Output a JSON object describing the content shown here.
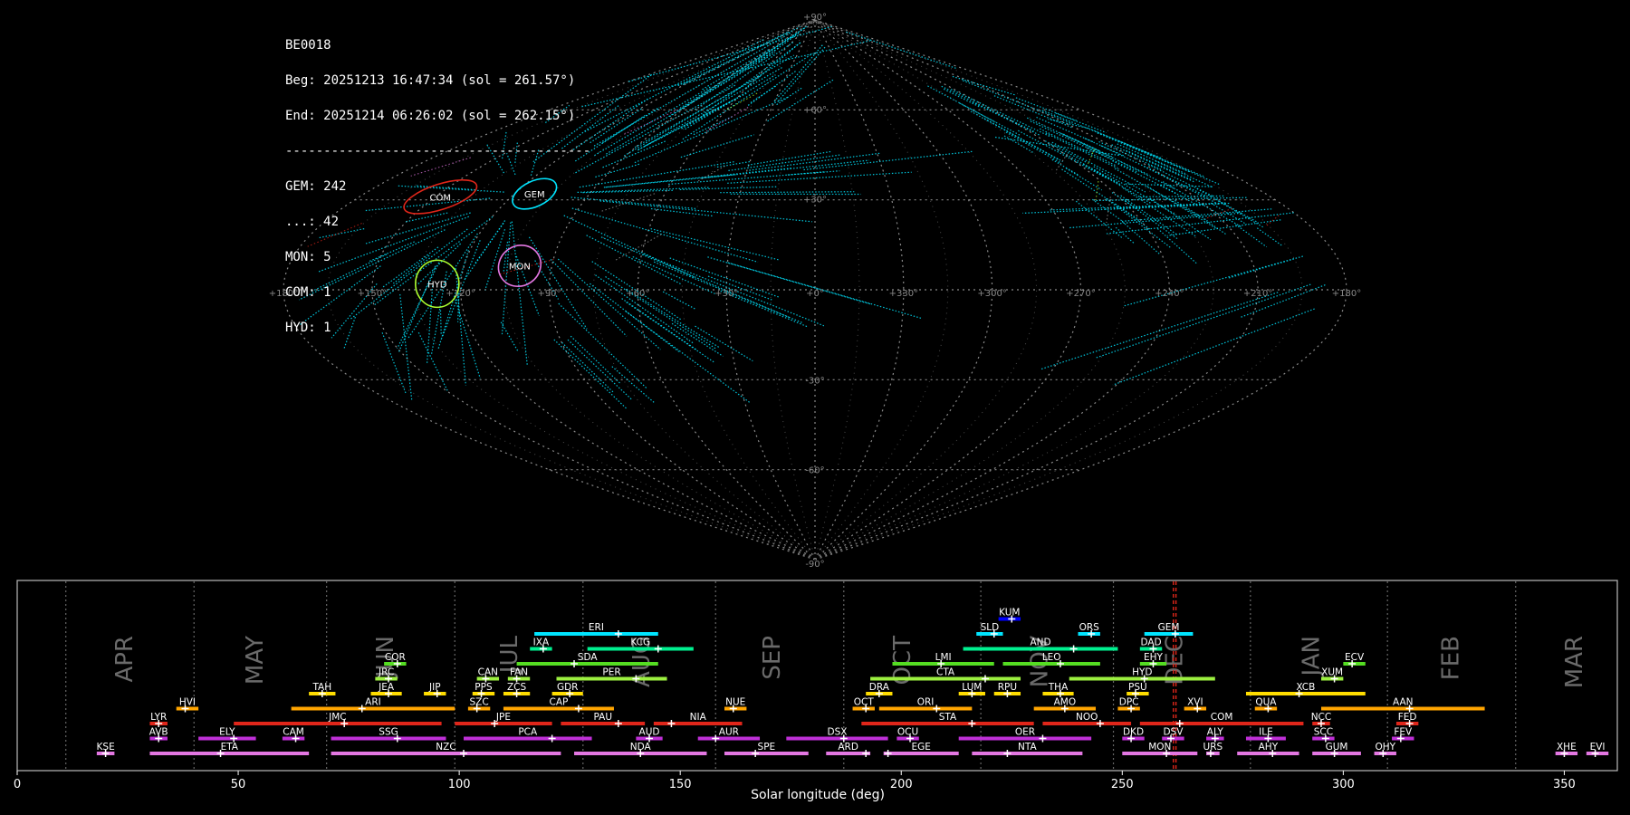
{
  "info_lines": [
    "BE0018",
    "Beg: 20251213 16:47:34 (sol = 261.57°)",
    "End: 20251214 06:26:02 (sol = 262.15°)",
    "----------------------------------------",
    "GEM: 242",
    "...: 42",
    "MON: 5",
    "COM: 1",
    "HYD: 1"
  ],
  "sky_map": {
    "projection": "sinusoidal",
    "lon_labels": [
      "+180°",
      "+150°",
      "+120°",
      "+90°",
      "+60°",
      "+30°",
      "+0°",
      "+330°",
      "+300°",
      "+270°",
      "+240°",
      "+210°",
      "+180°"
    ],
    "lat_labels": [
      "+90°",
      "+60°",
      "+30°",
      "-30°",
      "-60°",
      "-90°"
    ],
    "radiants": [
      {
        "code": "COM",
        "ra": 148,
        "dec": 31,
        "color": "#e0261a"
      },
      {
        "code": "GEM",
        "ra": 112,
        "dec": 32,
        "color": "#00e5ff"
      },
      {
        "code": "MON",
        "ra": 101,
        "dec": 8,
        "color": "#e377e2"
      },
      {
        "code": "HYD",
        "ra": 128,
        "dec": 2,
        "color": "#adff2f"
      }
    ]
  },
  "chart_data": {
    "type": "timeline",
    "xlabel": "Solar longitude (deg)",
    "xlim": [
      0,
      362
    ],
    "xticks": [
      0,
      50,
      100,
      150,
      200,
      250,
      300,
      350
    ],
    "current_sol": [
      261.57,
      262.15
    ],
    "months": [
      {
        "name": "APR",
        "x": 24.5
      },
      {
        "name": "MAY",
        "x": 54
      },
      {
        "name": "JUN",
        "x": 83.5
      },
      {
        "name": "JUL",
        "x": 111.5
      },
      {
        "name": "AUG",
        "x": 141.5
      },
      {
        "name": "SEP",
        "x": 171
      },
      {
        "name": "OCT",
        "x": 200.5
      },
      {
        "name": "NOV",
        "x": 231.5
      },
      {
        "name": "DEC",
        "x": 262
      },
      {
        "name": "JAN",
        "x": 293
      },
      {
        "name": "FEB",
        "x": 324.5
      },
      {
        "name": "MAR",
        "x": 352.5
      }
    ],
    "month_boundaries": [
      11,
      40,
      70,
      99,
      128,
      158,
      187,
      218,
      248,
      279,
      310,
      339
    ],
    "showers": [
      {
        "code": "KUM",
        "start": 222,
        "end": 227,
        "peak": 225,
        "row": 9,
        "color": "#0000ff"
      },
      {
        "code": "ERI",
        "start": 117,
        "end": 145,
        "peak": 136,
        "row": 8,
        "color": "#00e5ff"
      },
      {
        "code": "SLD",
        "start": 217,
        "end": 223,
        "peak": 221,
        "row": 8,
        "color": "#00e5ff"
      },
      {
        "code": "ORS",
        "start": 240,
        "end": 245,
        "peak": 243,
        "row": 8,
        "color": "#00e5ff"
      },
      {
        "code": "GEM",
        "start": 255,
        "end": 266,
        "peak": 262,
        "row": 8,
        "color": "#00e5ff"
      },
      {
        "code": "IXA",
        "start": 116,
        "end": 121,
        "peak": 119,
        "row": 7,
        "color": "#00f090"
      },
      {
        "code": "KCG",
        "start": 129,
        "end": 153,
        "peak": 145,
        "row": 7,
        "color": "#00f090"
      },
      {
        "code": "AND",
        "start": 214,
        "end": 249,
        "peak": 239,
        "row": 7,
        "color": "#00f090"
      },
      {
        "code": "DAD",
        "start": 254,
        "end": 259,
        "peak": 257,
        "row": 7,
        "color": "#00f090"
      },
      {
        "code": "COR",
        "start": 83,
        "end": 88,
        "peak": 86,
        "row": 6,
        "color": "#55dd22"
      },
      {
        "code": "SDA",
        "start": 113,
        "end": 145,
        "peak": 126,
        "row": 6,
        "color": "#55dd22"
      },
      {
        "code": "LMI",
        "start": 198,
        "end": 221,
        "peak": 209,
        "row": 6,
        "color": "#55dd22"
      },
      {
        "code": "LEO",
        "start": 223,
        "end": 245,
        "peak": 236,
        "row": 6,
        "color": "#55dd22"
      },
      {
        "code": "EHY",
        "start": 254,
        "end": 260,
        "peak": 257,
        "row": 6,
        "color": "#55dd22"
      },
      {
        "code": "ECV",
        "start": 300,
        "end": 305,
        "peak": 302,
        "row": 6,
        "color": "#55dd22"
      },
      {
        "code": "JRC",
        "start": 81,
        "end": 86,
        "peak": 84,
        "row": 5,
        "color": "#9cf040"
      },
      {
        "code": "CAN",
        "start": 104,
        "end": 109,
        "peak": 106,
        "row": 5,
        "color": "#9cf040"
      },
      {
        "code": "FAN",
        "start": 111,
        "end": 116,
        "peak": 113,
        "row": 5,
        "color": "#9cf040"
      },
      {
        "code": "PER",
        "start": 122,
        "end": 147,
        "peak": 140,
        "row": 5,
        "color": "#9cf040"
      },
      {
        "code": "CTA",
        "start": 193,
        "end": 227,
        "peak": 219,
        "row": 5,
        "color": "#9cf040"
      },
      {
        "code": "HYD",
        "start": 238,
        "end": 271,
        "peak": 255,
        "row": 5,
        "color": "#9cf040"
      },
      {
        "code": "XUM",
        "start": 295,
        "end": 300,
        "peak": 298,
        "row": 5,
        "color": "#9cf040"
      },
      {
        "code": "TAH",
        "start": 66,
        "end": 72,
        "peak": 69,
        "row": 4,
        "color": "#ffdd00"
      },
      {
        "code": "JEA",
        "start": 80,
        "end": 87,
        "peak": 84,
        "row": 4,
        "color": "#ffdd00"
      },
      {
        "code": "JIP",
        "start": 92,
        "end": 97,
        "peak": 95,
        "row": 4,
        "color": "#ffdd00"
      },
      {
        "code": "PPS",
        "start": 103,
        "end": 108,
        "peak": 105,
        "row": 4,
        "color": "#ffdd00"
      },
      {
        "code": "ZCS",
        "start": 110,
        "end": 116,
        "peak": 113,
        "row": 4,
        "color": "#ffdd00"
      },
      {
        "code": "GDR",
        "start": 121,
        "end": 128,
        "peak": 125,
        "row": 4,
        "color": "#ffdd00"
      },
      {
        "code": "DRA",
        "start": 192,
        "end": 198,
        "peak": 195,
        "row": 4,
        "color": "#ffdd00"
      },
      {
        "code": "LUM",
        "start": 213,
        "end": 219,
        "peak": 216,
        "row": 4,
        "color": "#ffdd00"
      },
      {
        "code": "RPU",
        "start": 221,
        "end": 227,
        "peak": 224,
        "row": 4,
        "color": "#ffdd00"
      },
      {
        "code": "THA",
        "start": 232,
        "end": 239,
        "peak": 236,
        "row": 4,
        "color": "#ffdd00"
      },
      {
        "code": "PSU",
        "start": 251,
        "end": 256,
        "peak": 253,
        "row": 4,
        "color": "#ffdd00"
      },
      {
        "code": "XCB",
        "start": 278,
        "end": 305,
        "peak": 290,
        "row": 4,
        "color": "#ffdd00"
      },
      {
        "code": "HVI",
        "start": 36,
        "end": 41,
        "peak": 38,
        "row": 3,
        "color": "#ffa500"
      },
      {
        "code": "ARI",
        "start": 62,
        "end": 99,
        "peak": 78,
        "row": 3,
        "color": "#ffa500"
      },
      {
        "code": "SZC",
        "start": 102,
        "end": 107,
        "peak": 104,
        "row": 3,
        "color": "#ffa500"
      },
      {
        "code": "CAP",
        "start": 110,
        "end": 135,
        "peak": 127,
        "row": 3,
        "color": "#ffa500"
      },
      {
        "code": "NUE",
        "start": 160,
        "end": 165,
        "peak": 162,
        "row": 3,
        "color": "#ffa500"
      },
      {
        "code": "OCT",
        "start": 189,
        "end": 194,
        "peak": 192,
        "row": 3,
        "color": "#ffa500"
      },
      {
        "code": "ORI",
        "start": 195,
        "end": 216,
        "peak": 208,
        "row": 3,
        "color": "#ffa500"
      },
      {
        "code": "AMO",
        "start": 230,
        "end": 244,
        "peak": 237,
        "row": 3,
        "color": "#ffa500"
      },
      {
        "code": "DPC",
        "start": 249,
        "end": 254,
        "peak": 252,
        "row": 3,
        "color": "#ffa500"
      },
      {
        "code": "XVI",
        "start": 264,
        "end": 269,
        "peak": 267,
        "row": 3,
        "color": "#ffa500"
      },
      {
        "code": "QUA",
        "start": 280,
        "end": 285,
        "peak": 283,
        "row": 3,
        "color": "#ffa500"
      },
      {
        "code": "AAN",
        "start": 295,
        "end": 332,
        "peak": 315,
        "row": 3,
        "color": "#ffa500"
      },
      {
        "code": "LYR",
        "start": 30,
        "end": 34,
        "peak": 32,
        "row": 2,
        "color": "#e0261a"
      },
      {
        "code": "JMC",
        "start": 49,
        "end": 96,
        "peak": 74,
        "row": 2,
        "color": "#e0261a"
      },
      {
        "code": "JPE",
        "start": 99,
        "end": 121,
        "peak": 108,
        "row": 2,
        "color": "#e0261a"
      },
      {
        "code": "PAU",
        "start": 123,
        "end": 142,
        "peak": 136,
        "row": 2,
        "color": "#e0261a"
      },
      {
        "code": "NIA",
        "start": 144,
        "end": 164,
        "peak": 148,
        "row": 2,
        "color": "#e0261a"
      },
      {
        "code": "STA",
        "start": 191,
        "end": 230,
        "peak": 216,
        "row": 2,
        "color": "#e0261a"
      },
      {
        "code": "NOO",
        "start": 232,
        "end": 252,
        "peak": 245,
        "row": 2,
        "color": "#e0261a"
      },
      {
        "code": "COM",
        "start": 254,
        "end": 291,
        "peak": 263,
        "row": 2,
        "color": "#e0261a"
      },
      {
        "code": "NCC",
        "start": 293,
        "end": 297,
        "peak": 295,
        "row": 2,
        "color": "#e0261a"
      },
      {
        "code": "FED",
        "start": 312,
        "end": 317,
        "peak": 315,
        "row": 2,
        "color": "#e0261a"
      },
      {
        "code": "AVB",
        "start": 30,
        "end": 34,
        "peak": 32,
        "row": 1,
        "color": "#c030d8"
      },
      {
        "code": "ELY",
        "start": 41,
        "end": 54,
        "peak": 49,
        "row": 1,
        "color": "#c030d8"
      },
      {
        "code": "CAM",
        "start": 60,
        "end": 65,
        "peak": 63,
        "row": 1,
        "color": "#c030d8"
      },
      {
        "code": "SSG",
        "start": 71,
        "end": 97,
        "peak": 86,
        "row": 1,
        "color": "#c030d8"
      },
      {
        "code": "PCA",
        "start": 101,
        "end": 130,
        "peak": 121,
        "row": 1,
        "color": "#c030d8"
      },
      {
        "code": "AUD",
        "start": 140,
        "end": 146,
        "peak": 143,
        "row": 1,
        "color": "#c030d8"
      },
      {
        "code": "AUR",
        "start": 154,
        "end": 168,
        "peak": 158,
        "row": 1,
        "color": "#c030d8"
      },
      {
        "code": "DSX",
        "start": 174,
        "end": 197,
        "peak": 187,
        "row": 1,
        "color": "#c030d8"
      },
      {
        "code": "OCU",
        "start": 199,
        "end": 204,
        "peak": 202,
        "row": 1,
        "color": "#c030d8"
      },
      {
        "code": "OER",
        "start": 213,
        "end": 243,
        "peak": 232,
        "row": 1,
        "color": "#c030d8"
      },
      {
        "code": "DKD",
        "start": 250,
        "end": 255,
        "peak": 252,
        "row": 1,
        "color": "#c030d8"
      },
      {
        "code": "DSV",
        "start": 259,
        "end": 264,
        "peak": 261,
        "row": 1,
        "color": "#c030d8"
      },
      {
        "code": "ALY",
        "start": 269,
        "end": 273,
        "peak": 271,
        "row": 1,
        "color": "#c030d8"
      },
      {
        "code": "ILE",
        "start": 278,
        "end": 287,
        "peak": 283,
        "row": 1,
        "color": "#c030d8"
      },
      {
        "code": "SCC",
        "start": 293,
        "end": 298,
        "peak": 296,
        "row": 1,
        "color": "#c030d8"
      },
      {
        "code": "FEV",
        "start": 311,
        "end": 316,
        "peak": 313,
        "row": 1,
        "color": "#c030d8"
      },
      {
        "code": "KSE",
        "start": 18,
        "end": 22,
        "peak": 20,
        "row": 0,
        "color": "#e377e2"
      },
      {
        "code": "ETA",
        "start": 30,
        "end": 66,
        "peak": 46,
        "row": 0,
        "color": "#e377e2"
      },
      {
        "code": "NZC",
        "start": 71,
        "end": 123,
        "peak": 101,
        "row": 0,
        "color": "#e377e2"
      },
      {
        "code": "NDA",
        "start": 126,
        "end": 156,
        "peak": 141,
        "row": 0,
        "color": "#e377e2"
      },
      {
        "code": "SPE",
        "start": 160,
        "end": 179,
        "peak": 167,
        "row": 0,
        "color": "#e377e2"
      },
      {
        "code": "ARD",
        "start": 183,
        "end": 193,
        "peak": 192,
        "row": 0,
        "color": "#e377e2"
      },
      {
        "code": "EGE",
        "start": 196,
        "end": 213,
        "peak": 197,
        "row": 0,
        "color": "#e377e2"
      },
      {
        "code": "NTA",
        "start": 216,
        "end": 241,
        "peak": 224,
        "row": 0,
        "color": "#e377e2"
      },
      {
        "code": "MON",
        "start": 250,
        "end": 267,
        "peak": 260,
        "row": 0,
        "color": "#e377e2"
      },
      {
        "code": "URS",
        "start": 269,
        "end": 272,
        "peak": 270,
        "row": 0,
        "color": "#e377e2"
      },
      {
        "code": "AHY",
        "start": 276,
        "end": 290,
        "peak": 284,
        "row": 0,
        "color": "#e377e2"
      },
      {
        "code": "GUM",
        "start": 293,
        "end": 304,
        "peak": 298,
        "row": 0,
        "color": "#e377e2"
      },
      {
        "code": "OHY",
        "start": 307,
        "end": 312,
        "peak": 309,
        "row": 0,
        "color": "#e377e2"
      },
      {
        "code": "XHE",
        "start": 348,
        "end": 353,
        "peak": 350,
        "row": 0,
        "color": "#e377e2"
      },
      {
        "code": "EVI",
        "start": 355,
        "end": 360,
        "peak": 357,
        "row": 0,
        "color": "#e377e2"
      }
    ]
  }
}
